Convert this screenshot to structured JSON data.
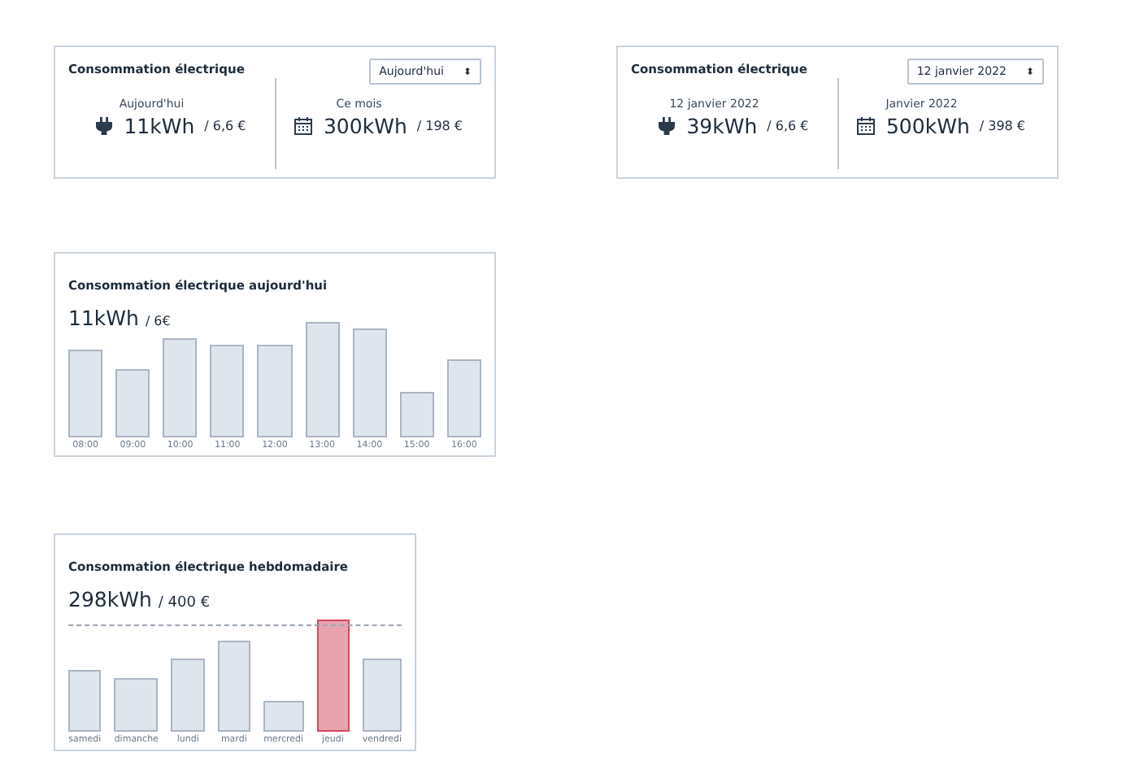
{
  "summary_cards": [
    {
      "title": "Consommation électrique",
      "period_select": {
        "value": "Aujourd'hui",
        "arrows": "⬍"
      },
      "stats": [
        {
          "kind": "plug",
          "label": "Aujourd'hui",
          "value": "11kWh",
          "cost": "/ 6,6 €"
        },
        {
          "kind": "calendar",
          "label": "Ce mois",
          "value": "300kWh",
          "cost": "/ 198 €"
        }
      ]
    },
    {
      "title": "Consommation électrique",
      "period_select": {
        "value": "12 janvier 2022",
        "arrows": "⬍"
      },
      "stats": [
        {
          "kind": "plug",
          "label": "12 janvier 2022",
          "value": "39kWh",
          "cost": "/ 6,6 €"
        },
        {
          "kind": "calendar",
          "label": "Janvier 2022",
          "value": "500kWh",
          "cost": "/ 398 €"
        }
      ]
    }
  ],
  "daily_chart": {
    "title": "Consommation électrique aujourd'hui",
    "value": "11kWh",
    "cost": "/ 6€",
    "bars": [
      {
        "label": "08:00",
        "highlighted": false
      },
      {
        "label": "09:00",
        "highlighted": false
      },
      {
        "label": "10:00",
        "highlighted": false
      },
      {
        "label": "11:00",
        "highlighted": false
      },
      {
        "label": "12:00",
        "highlighted": false
      },
      {
        "label": "13:00",
        "highlighted": false
      },
      {
        "label": "14:00",
        "highlighted": false
      },
      {
        "label": "15:00",
        "highlighted": false
      },
      {
        "label": "16:00",
        "highlighted": false
      }
    ]
  },
  "weekly_chart": {
    "title": "Consommation électrique hebdomadaire",
    "value": "298kWh",
    "cost": "/ 400 €",
    "limit_line": true,
    "bars": [
      {
        "label": "samedi",
        "highlighted": false
      },
      {
        "label": "dimanche",
        "highlighted": false
      },
      {
        "label": "lundi",
        "highlighted": false
      },
      {
        "label": "mardi",
        "highlighted": false
      },
      {
        "label": "mercredi",
        "highlighted": false
      },
      {
        "label": "jeudi",
        "highlighted": true
      },
      {
        "label": "vendredi",
        "highlighted": false
      }
    ]
  }
}
